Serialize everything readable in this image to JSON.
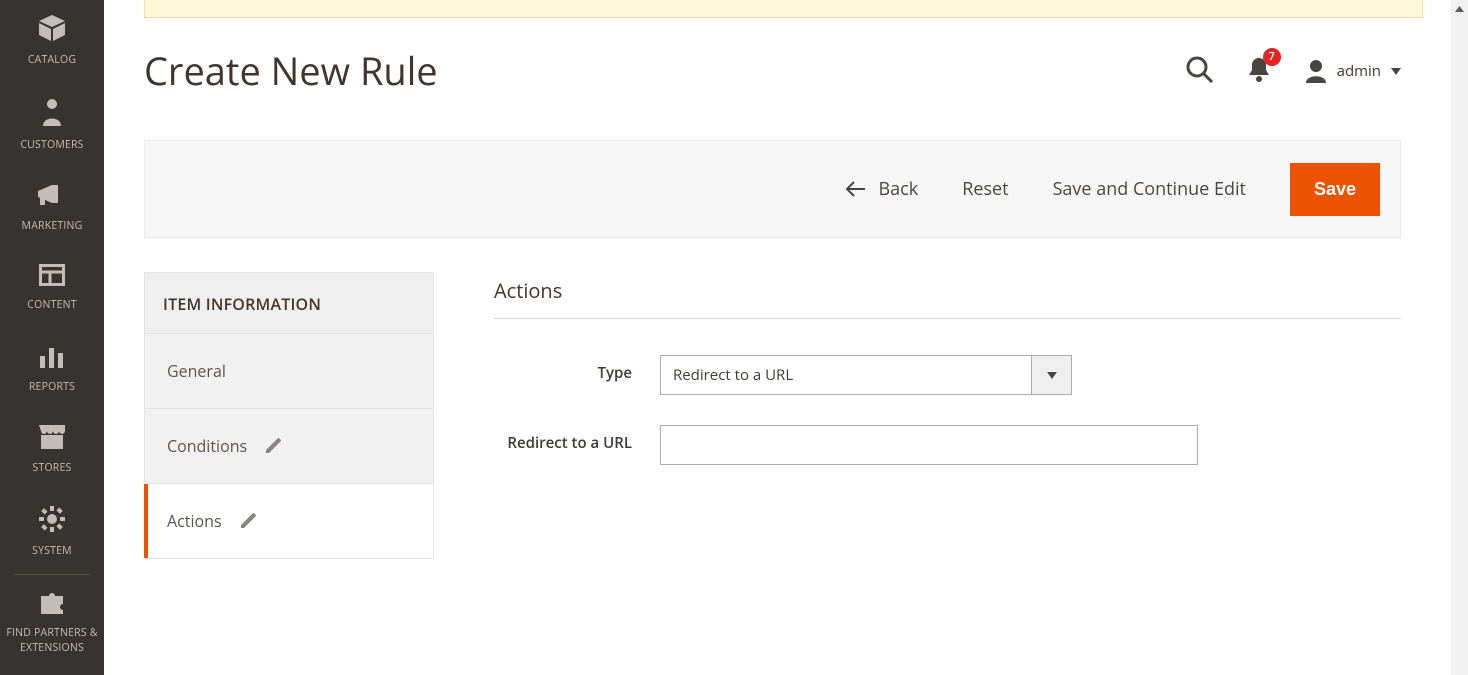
{
  "sidebar": {
    "items": [
      {
        "id": "catalog",
        "label": "CATALOG"
      },
      {
        "id": "customers",
        "label": "CUSTOMERS"
      },
      {
        "id": "marketing",
        "label": "MARKETING"
      },
      {
        "id": "content",
        "label": "CONTENT"
      },
      {
        "id": "reports",
        "label": "REPORTS"
      },
      {
        "id": "stores",
        "label": "STORES"
      },
      {
        "id": "system",
        "label": "SYSTEM"
      },
      {
        "id": "partners",
        "label": "FIND PARTNERS & EXTENSIONS"
      }
    ]
  },
  "header": {
    "page_title": "Create New Rule",
    "notifications_count": "7",
    "user_name": "admin"
  },
  "toolbar": {
    "back_label": "Back",
    "reset_label": "Reset",
    "save_continue_label": "Save and Continue Edit",
    "save_label": "Save"
  },
  "side_panel": {
    "heading": "ITEM INFORMATION",
    "tabs": [
      {
        "id": "general",
        "label": "General",
        "editable": false
      },
      {
        "id": "conditions",
        "label": "Conditions",
        "editable": true
      },
      {
        "id": "actions",
        "label": "Actions",
        "editable": true
      }
    ],
    "active_tab": "actions"
  },
  "form": {
    "fieldset_title": "Actions",
    "fields": {
      "type": {
        "label": "Type",
        "selected": "Redirect to a URL"
      },
      "redirect_url": {
        "label": "Redirect to a URL",
        "value": ""
      }
    }
  }
}
